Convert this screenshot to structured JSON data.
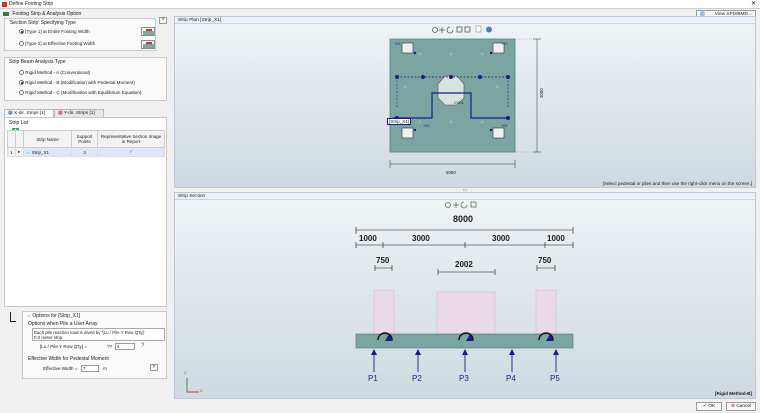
{
  "window": {
    "title": "Define Footing Strip",
    "close": "✕"
  },
  "left": {
    "section_title": "Footing Strip & Analysis Option",
    "help": "?",
    "spec_group": {
      "title": "'Section Strip' Specifying Type",
      "options": [
        "[Type 1] at Entire Footing Width",
        "[Type 2] at Effective Footing Width"
      ],
      "selected": 0
    },
    "beam_group": {
      "title": "Strip Beam Analysis Type",
      "options": [
        "Rigid Method - A (Conventional)",
        "Rigid Method - B (Modification with Pedestal Moment)",
        "Rigid Method - C (Modification with Equilibrium Equation)"
      ],
      "selected": 1
    },
    "tabs": [
      "X-dir. Strips [1]",
      "Y-dir. Strips [1]"
    ],
    "strip_list": {
      "title": "Strip List",
      "add": "+",
      "columns": [
        "Strip Name",
        "Support Points",
        "Representative Section Image in Report"
      ],
      "rows": [
        {
          "index": "1",
          "name": "Strip_X1",
          "points": "3",
          "check": "✓"
        }
      ]
    },
    "options": {
      "title": "Options for [Strip_X1]",
      "pile_group": "Options when Pile a User Array",
      "pile_text_1": "Each pile reaction load is dived by '[Lu / Pile Y Row Q'ty]'",
      "pile_text_2": "0.0 meter strip.",
      "lu_label": "[Lu / Pile Y Row Q'ty] =",
      "lu_qty": "??",
      "lu_value": "4",
      "help": "?",
      "eff_group": "Effective Width for Pedestal Moment",
      "eff_label": "Effective Width =",
      "eff_value": "7",
      "eff_unit": "m"
    }
  },
  "right": {
    "view_button": "View SFD/BMD...",
    "plan": {
      "title": "Strip Plan [Strip_X1]",
      "status": "[Select pedestal or piles and then use the right-click menu on the screen.]",
      "strip_label": "[Strip_X1]",
      "center_label": "C001",
      "dim_width": "5050",
      "dim_height": "3050",
      "post_labels": [
        "+01",
        "+02",
        "+03",
        "+04"
      ]
    },
    "section": {
      "title": "Strip Section",
      "total": "8000",
      "segments": [
        "1000",
        "3000",
        "3000",
        "1000"
      ],
      "ped_widths": [
        "750",
        "2002",
        "750"
      ],
      "loads": [
        "P1",
        "P2",
        "P3",
        "P4",
        "P5"
      ],
      "method": "[Rigid Method-B]",
      "axis_x": "X",
      "axis_z": "Z"
    }
  },
  "footer": {
    "ok": "OK",
    "cancel": "Cancel"
  },
  "colors": {
    "accent": "#1a1a8c",
    "strip": "#6f9e95",
    "footing": "#7aa5a0",
    "pedestal": "#ead9e6"
  }
}
